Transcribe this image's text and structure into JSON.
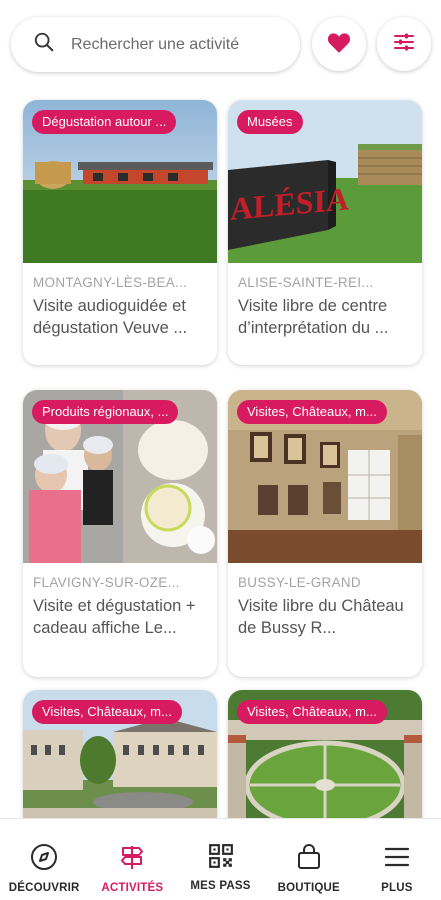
{
  "search": {
    "placeholder": "Rechercher une activité"
  },
  "header": {
    "favorite_icon": "heart-icon",
    "filter_icon": "sliders-icon"
  },
  "colors": {
    "accent": "#d81b60",
    "text": "#555555",
    "muted": "#a3a3a3"
  },
  "cards": [
    {
      "badge": "Dégustation  autour ...",
      "location": "MONTAGNY-LÈS-BEA...",
      "title": "Visite audioguidée et dégustation Veuve ..."
    },
    {
      "badge": "Musées",
      "location": "ALISE-SAINTE-REI...",
      "title": "Visite libre de centre d’interprétation du ...",
      "sign": "ALÉSIA"
    },
    {
      "badge": "Produits régionaux, ...",
      "location": "FLAVIGNY-SUR-OZE...",
      "title": "Visite et dégustation + cadeau affiche Le..."
    },
    {
      "badge": "Visites, Châteaux, m...",
      "location": "BUSSY-LE-GRAND",
      "title": "Visite libre du Château de Bussy R..."
    },
    {
      "badge": "Visites, Châteaux, m...",
      "location": "",
      "title": ""
    },
    {
      "badge": "Visites, Châteaux, m...",
      "location": "",
      "title": ""
    }
  ],
  "nav": [
    {
      "label": "DÉCOUVRIR",
      "icon": "compass-icon"
    },
    {
      "label": "ACTIVITÉS",
      "icon": "signpost-icon",
      "active": true
    },
    {
      "label": "MES PASS",
      "icon": "qr-code-icon"
    },
    {
      "label": "BOUTIQUE",
      "icon": "shopping-bag-icon"
    },
    {
      "label": "PLUS",
      "icon": "menu-icon"
    }
  ]
}
